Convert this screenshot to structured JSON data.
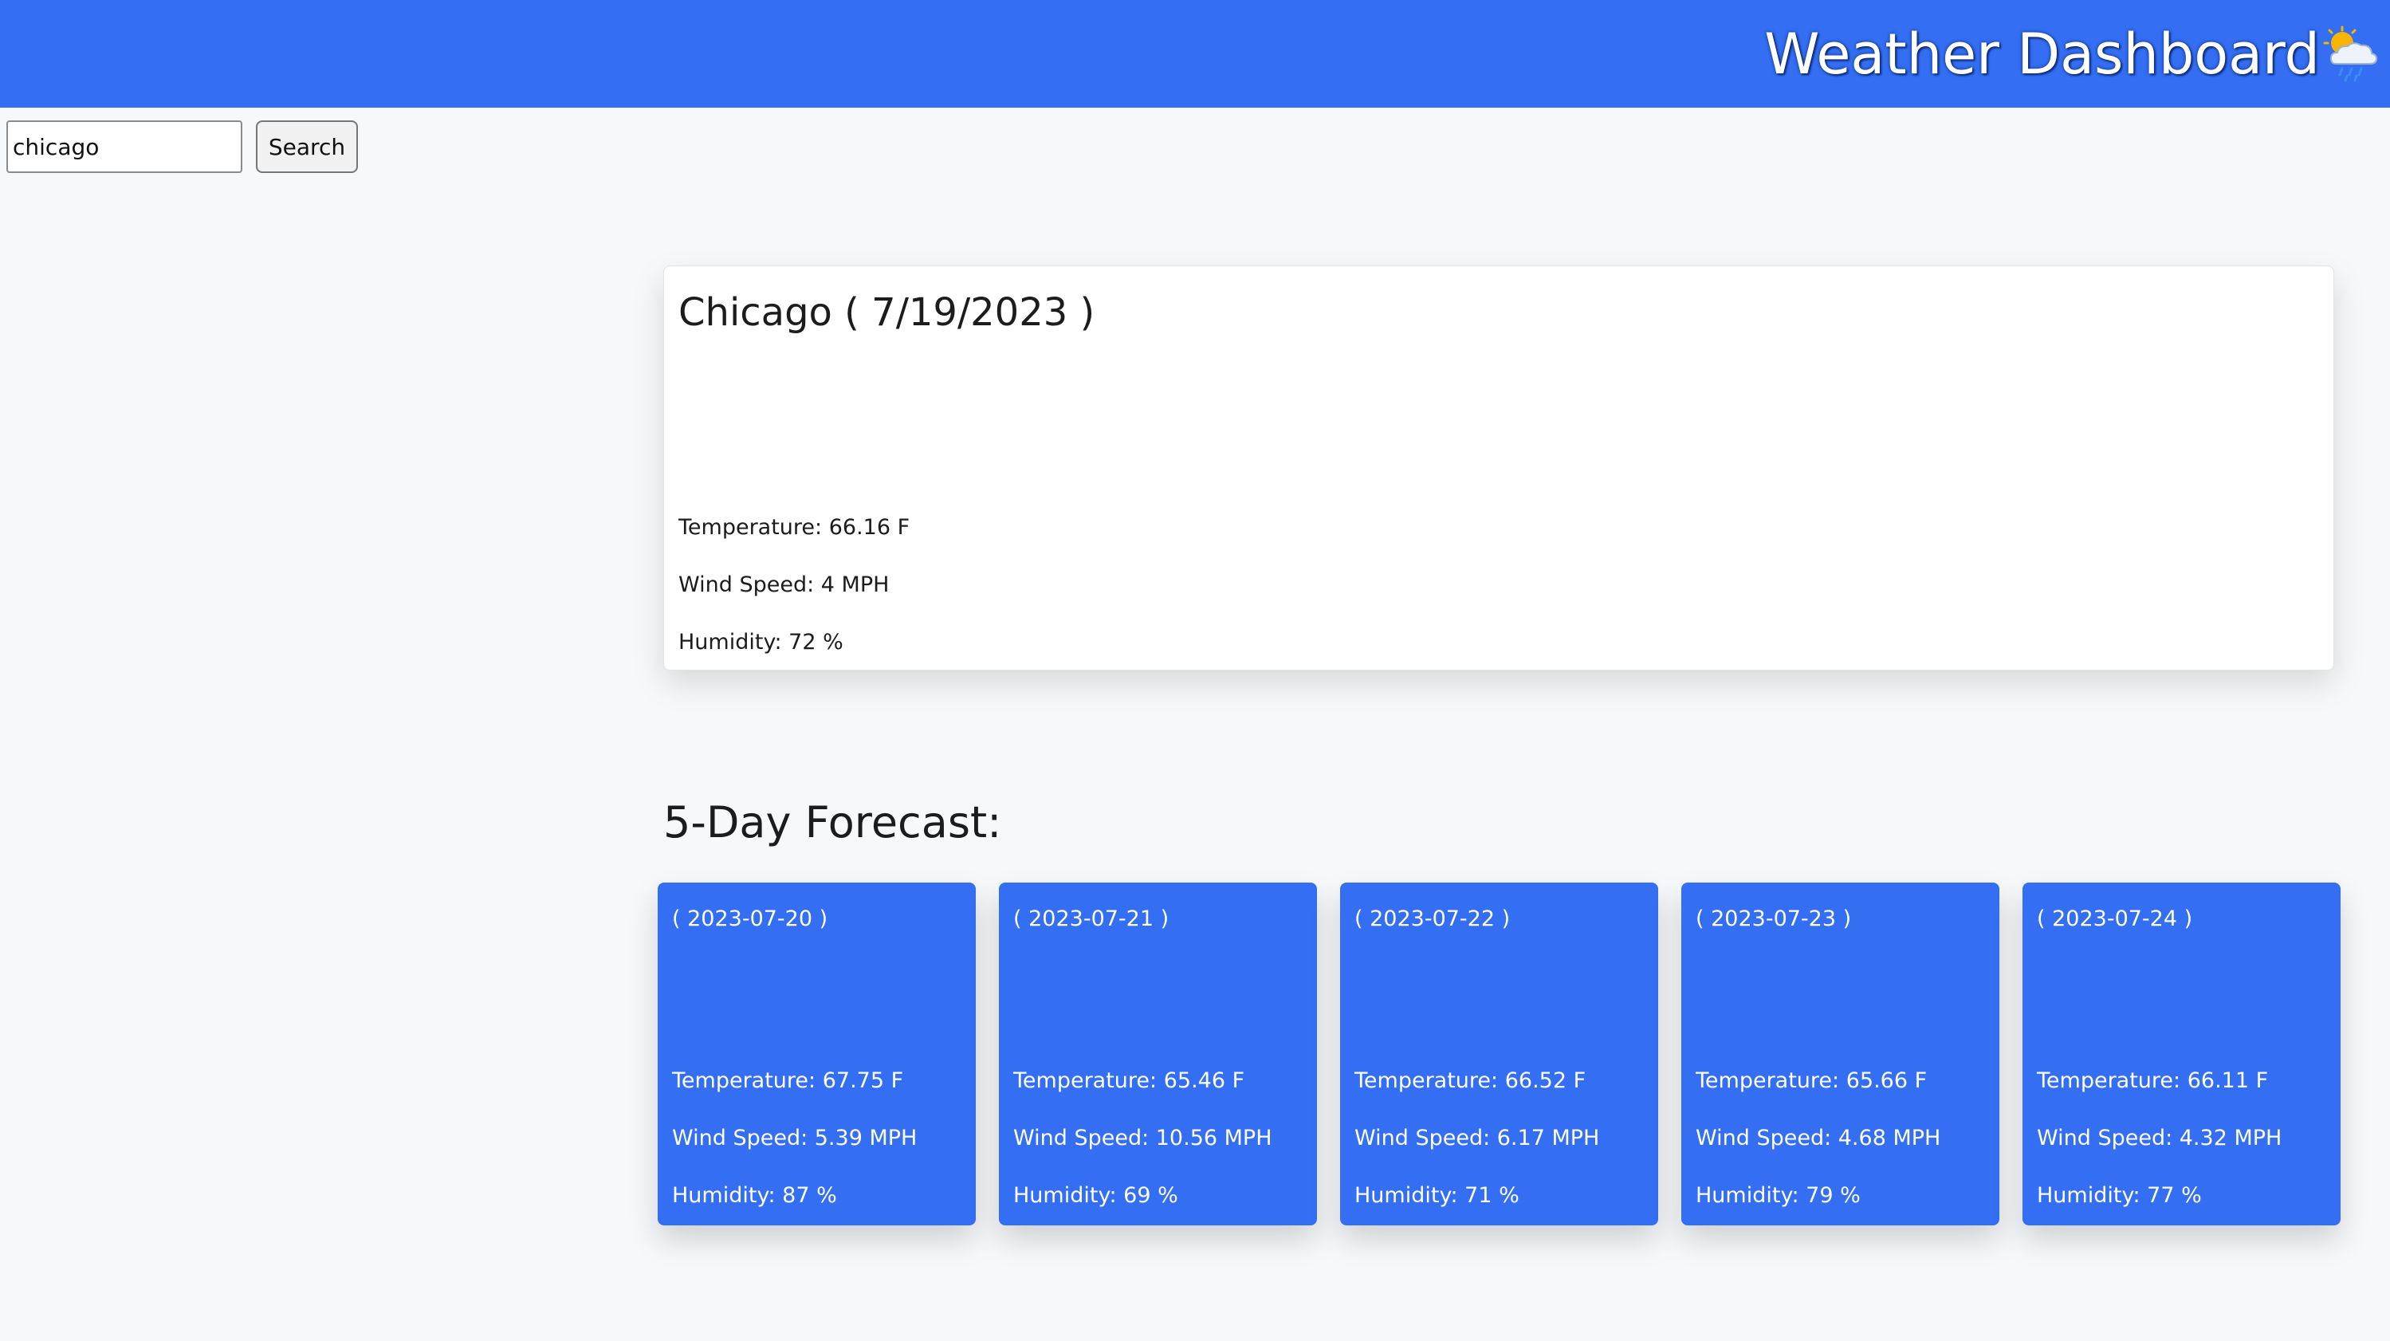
{
  "header": {
    "title": "Weather Dashboard",
    "icon": "sun-behind-rain-cloud-icon",
    "background_color": "#336ef3"
  },
  "search": {
    "value": "chicago",
    "button_label": "Search"
  },
  "current": {
    "title": "Chicago ( 7/19/2023 )",
    "temperature": "Temperature: 66.16 F",
    "wind": "Wind Speed: 4 MPH",
    "humidity": "Humidity: 72 %"
  },
  "forecast": {
    "heading": "5-Day Forecast:",
    "card_color": "#336ef3",
    "days": [
      {
        "date": "( 2023-07-20 )",
        "temperature": "Temperature: 67.75 F",
        "wind": "Wind Speed: 5.39 MPH",
        "humidity": "Humidity: 87 %"
      },
      {
        "date": "( 2023-07-21 )",
        "temperature": "Temperature: 65.46 F",
        "wind": "Wind Speed: 10.56 MPH",
        "humidity": "Humidity: 69 %"
      },
      {
        "date": "( 2023-07-22 )",
        "temperature": "Temperature: 66.52 F",
        "wind": "Wind Speed: 6.17 MPH",
        "humidity": "Humidity: 71 %"
      },
      {
        "date": "( 2023-07-23 )",
        "temperature": "Temperature: 65.66 F",
        "wind": "Wind Speed: 4.68 MPH",
        "humidity": "Humidity: 79 %"
      },
      {
        "date": "( 2023-07-24 )",
        "temperature": "Temperature: 66.11 F",
        "wind": "Wind Speed: 4.32 MPH",
        "humidity": "Humidity: 77 %"
      }
    ]
  }
}
